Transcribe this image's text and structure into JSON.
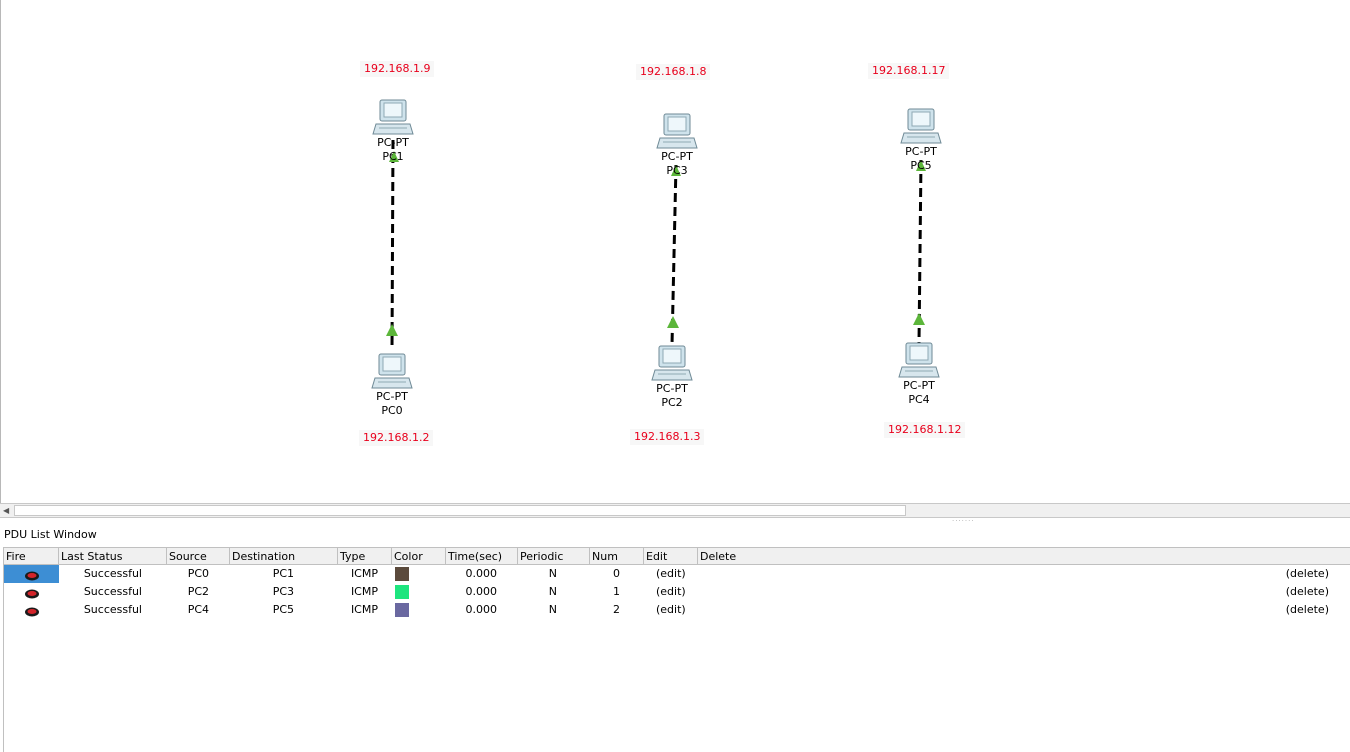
{
  "workspace": {
    "devices": [
      {
        "id": "pc1",
        "model": "PC-PT",
        "name": "PC1",
        "ip": "192.168.1.9"
      },
      {
        "id": "pc0",
        "model": "PC-PT",
        "name": "PC0",
        "ip": "192.168.1.2"
      },
      {
        "id": "pc3",
        "model": "PC-PT",
        "name": "PC3",
        "ip": "192.168.1.8"
      },
      {
        "id": "pc2",
        "model": "PC-PT",
        "name": "PC2",
        "ip": "192.168.1.3"
      },
      {
        "id": "pc5",
        "model": "PC-PT",
        "name": "PC5",
        "ip": "192.168.1.17"
      },
      {
        "id": "pc4",
        "model": "PC-PT",
        "name": "PC4",
        "ip": "192.168.1.12"
      }
    ],
    "links": [
      {
        "from": "PC1",
        "to": "PC0",
        "style": "crossover-dashed",
        "status": "up"
      },
      {
        "from": "PC3",
        "to": "PC2",
        "style": "crossover-dashed",
        "status": "up"
      },
      {
        "from": "PC5",
        "to": "PC4",
        "style": "crossover-dashed",
        "status": "up"
      }
    ],
    "colors": {
      "ip_label": "#e8001c",
      "link_up": "#5cb63a"
    }
  },
  "pdu_window": {
    "title": "PDU List Window",
    "columns": [
      "Fire",
      "Last Status",
      "Source",
      "Destination",
      "Type",
      "Color",
      "Time(sec)",
      "Periodic",
      "Num",
      "Edit",
      "Delete"
    ],
    "rows": [
      {
        "last_status": "Successful",
        "source": "PC0",
        "destination": "PC1",
        "type": "ICMP",
        "color": "#5b4a3c",
        "time": "0.000",
        "periodic": "N",
        "num": "0",
        "edit": "(edit)",
        "delete": "(delete)",
        "selected": true
      },
      {
        "last_status": "Successful",
        "source": "PC2",
        "destination": "PC3",
        "type": "ICMP",
        "color": "#1de57e",
        "time": "0.000",
        "periodic": "N",
        "num": "1",
        "edit": "(edit)",
        "delete": "(delete)",
        "selected": false
      },
      {
        "last_status": "Successful",
        "source": "PC4",
        "destination": "PC5",
        "type": "ICMP",
        "color": "#6a68a0",
        "time": "0.000",
        "periodic": "N",
        "num": "2",
        "edit": "(edit)",
        "delete": "(delete)",
        "selected": false
      }
    ]
  }
}
